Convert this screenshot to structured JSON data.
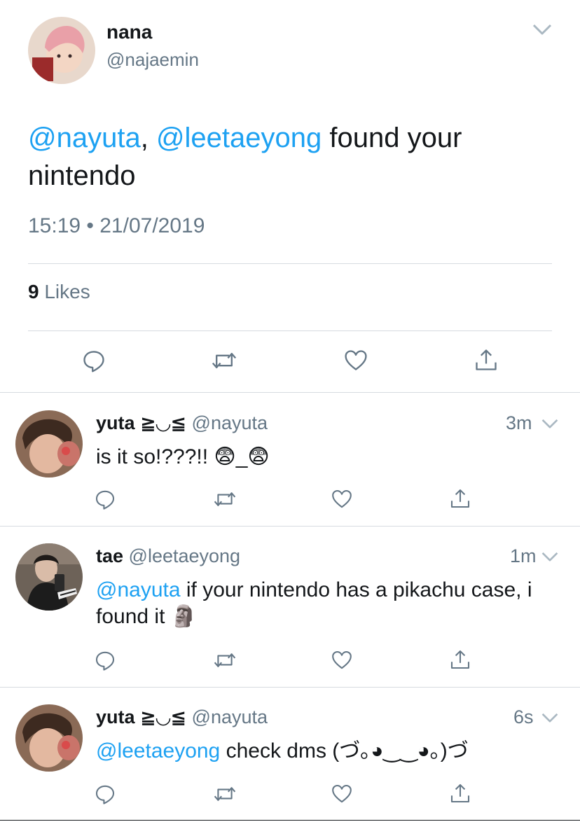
{
  "main_tweet": {
    "name": "nana",
    "handle": "@najaemin",
    "mention1": "@nayuta",
    "separator": ", ",
    "mention2": "@leetaeyong",
    "text": " found your nintendo",
    "timestamp": "15:19 • 21/07/2019",
    "likes_count": "9",
    "likes_label": " Likes",
    "icons": [
      "reply-icon",
      "retweet-icon",
      "like-icon",
      "share-icon"
    ]
  },
  "replies": [
    {
      "name": "yuta ≧◡≦",
      "handle": "@nayuta",
      "time": "3m",
      "mention": "",
      "text": "is it so!???!! 😨_😨"
    },
    {
      "name": "tae",
      "handle": "@leetaeyong",
      "time": "1m",
      "mention": "@nayuta",
      "text": " if your nintendo has a pikachu case, i found it 🗿"
    },
    {
      "name": "yuta ≧◡≦",
      "handle": "@nayuta",
      "time": "6s",
      "mention": "@leetaeyong",
      "text": " check dms (づ｡◕‿‿◕｡)づ"
    }
  ],
  "colors": {
    "link": "#1da1f2",
    "secondary_text": "#657786",
    "divider": "#d6dbe0"
  }
}
